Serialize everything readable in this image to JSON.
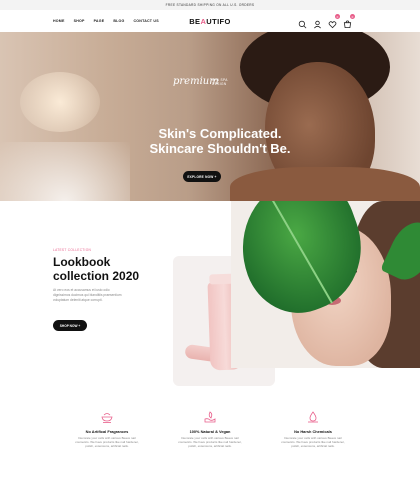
{
  "topbar": {
    "text": "FREE STANDARD SHIPPING ON ALL U.S. ORDERS"
  },
  "header": {
    "nav": [
      "HOME",
      "SHOP",
      "PAGE",
      "BLOG",
      "CONTACT US"
    ],
    "logo_start": "BE",
    "logo_accent": "A",
    "logo_end": "UTIFO",
    "cart_count": "0",
    "wishlist_count": "0",
    "icons": [
      "search-icon",
      "user-icon",
      "heart-icon",
      "cart-icon"
    ],
    "accent_color": "#e85e8a"
  },
  "hero": {
    "script_text": "premium",
    "script_small": "SPA SPA DESIGN",
    "headline_line1": "Skin's Complicated.",
    "headline_line2": "Skincare Shouldn't Be.",
    "cta": "EXPLORE NOW +"
  },
  "lookbook": {
    "eyebrow": "LATEST COLLECTION",
    "title_line1": "Lookbook",
    "title_line2": "collection 2020",
    "description": "At vero eos et accusamus et iusto odio dignissimos ducimus qui blanditiis praesentium voluptatum deleniti atque corrupti.",
    "cta": "SHOP NOW +"
  },
  "features": [
    {
      "icon": "bowl-icon",
      "title": "No Artifical Fragrances",
      "desc": "Decorate your cells with various Beaux nail cosmetics. We have products like nail hardener, polish, extensions, artificial nails."
    },
    {
      "icon": "hand-leaf-icon",
      "title": "100% Natural & Vegan",
      "desc": "Decorate your cells with various Beaux nail cosmetics. We have products like nail hardener, polish, extensions, artificial nails."
    },
    {
      "icon": "drop-icon",
      "title": "No Harsh Chemicals",
      "desc": "Decorate your cells with various Beaux nail cosmetics. We have products like nail hardener, polish, extensions, artificial nails."
    }
  ]
}
